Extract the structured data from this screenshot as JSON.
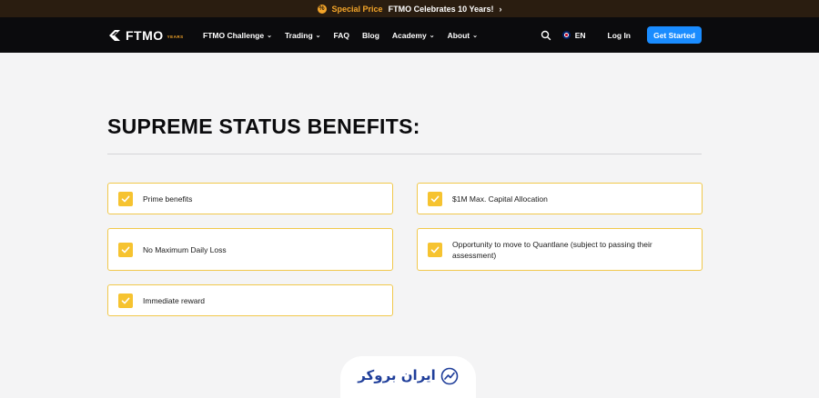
{
  "promo": {
    "special": "Special Price",
    "text": "FTMO Celebrates 10 Years!",
    "chevron": "›"
  },
  "logo": {
    "text": "FTMO",
    "years": "YEARS"
  },
  "nav": {
    "items": [
      {
        "label": "FTMO Challenge",
        "dropdown": true
      },
      {
        "label": "Trading",
        "dropdown": true
      },
      {
        "label": "FAQ",
        "dropdown": false
      },
      {
        "label": "Blog",
        "dropdown": false
      },
      {
        "label": "Academy",
        "dropdown": true
      },
      {
        "label": "About",
        "dropdown": true
      }
    ],
    "lang": "EN",
    "login": "Log In",
    "cta": "Get Started"
  },
  "section": {
    "title": "SUPREME STATUS BENEFITS:",
    "benefits": [
      "Prime benefits",
      "$1M Max. Capital Allocation",
      "No Maximum Daily Loss",
      "Opportunity to move to Quantlane (subject to passing their assessment)",
      "Immediate reward"
    ]
  },
  "watermark": {
    "text": "ایران بروکر"
  },
  "colors": {
    "accent_yellow": "#f6c330",
    "cta_blue": "#1a8cff",
    "nav_bg": "#0b0b0d",
    "promo_bg": "#2a1d10",
    "promo_orange": "#f4a529",
    "page_bg": "#f4f4f5"
  }
}
